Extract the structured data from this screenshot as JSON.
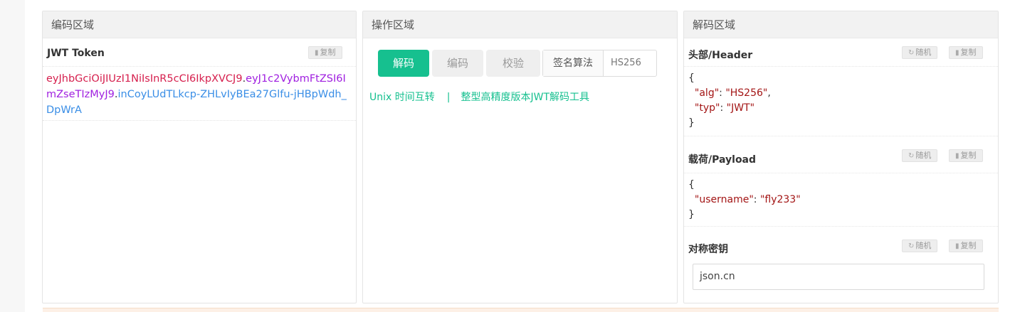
{
  "encode_panel": {
    "title": "编码区域",
    "token_label": "JWT Token",
    "copy_label": "复制",
    "token": {
      "header": "eyJhbGciOiJIUzI1NiIsInR5cCI6IkpXVCJ9",
      "payload": "eyJ1c2VybmFtZSI6ImZseTIzMyJ9",
      "signature": "inCoyLUdTLkcp-ZHLvIyBEa27Glfu-jHBpWdh_DpWrA",
      "dot": "."
    }
  },
  "ops_panel": {
    "title": "操作区域",
    "decode_button": "解码",
    "encode_button": "编码",
    "verify_button": "校验",
    "algo_label": "签名算法",
    "algo_value": "HS256",
    "link_unix": "Unix 时间互转",
    "link_separator": "|",
    "link_highprec": "整型高精度版本JWT解码工具"
  },
  "decode_panel": {
    "title": "解码区域",
    "random_label": "随机",
    "copy_label": "复制",
    "header_label": "头部/Header",
    "header_json": {
      "open": "{",
      "alg_key": "\"alg\"",
      "alg_value": "\"HS256\"",
      "typ_key": "\"typ\"",
      "typ_value": "\"JWT\"",
      "close": "}"
    },
    "payload_label": "载荷/Payload",
    "payload_json": {
      "open": "{",
      "username_key": "\"username\"",
      "username_value": "\"fly233\"",
      "close": "}"
    },
    "secret_label": "对称密钥",
    "secret_value": "json.cn"
  },
  "colors": {
    "accent": "#16c08f",
    "token_header": "#d6204e",
    "token_payload": "#a020e0",
    "token_signature": "#3a8ee6",
    "json_string": "#a31515"
  },
  "icons": {
    "copy": "clipboard-icon",
    "random": "refresh-icon"
  }
}
